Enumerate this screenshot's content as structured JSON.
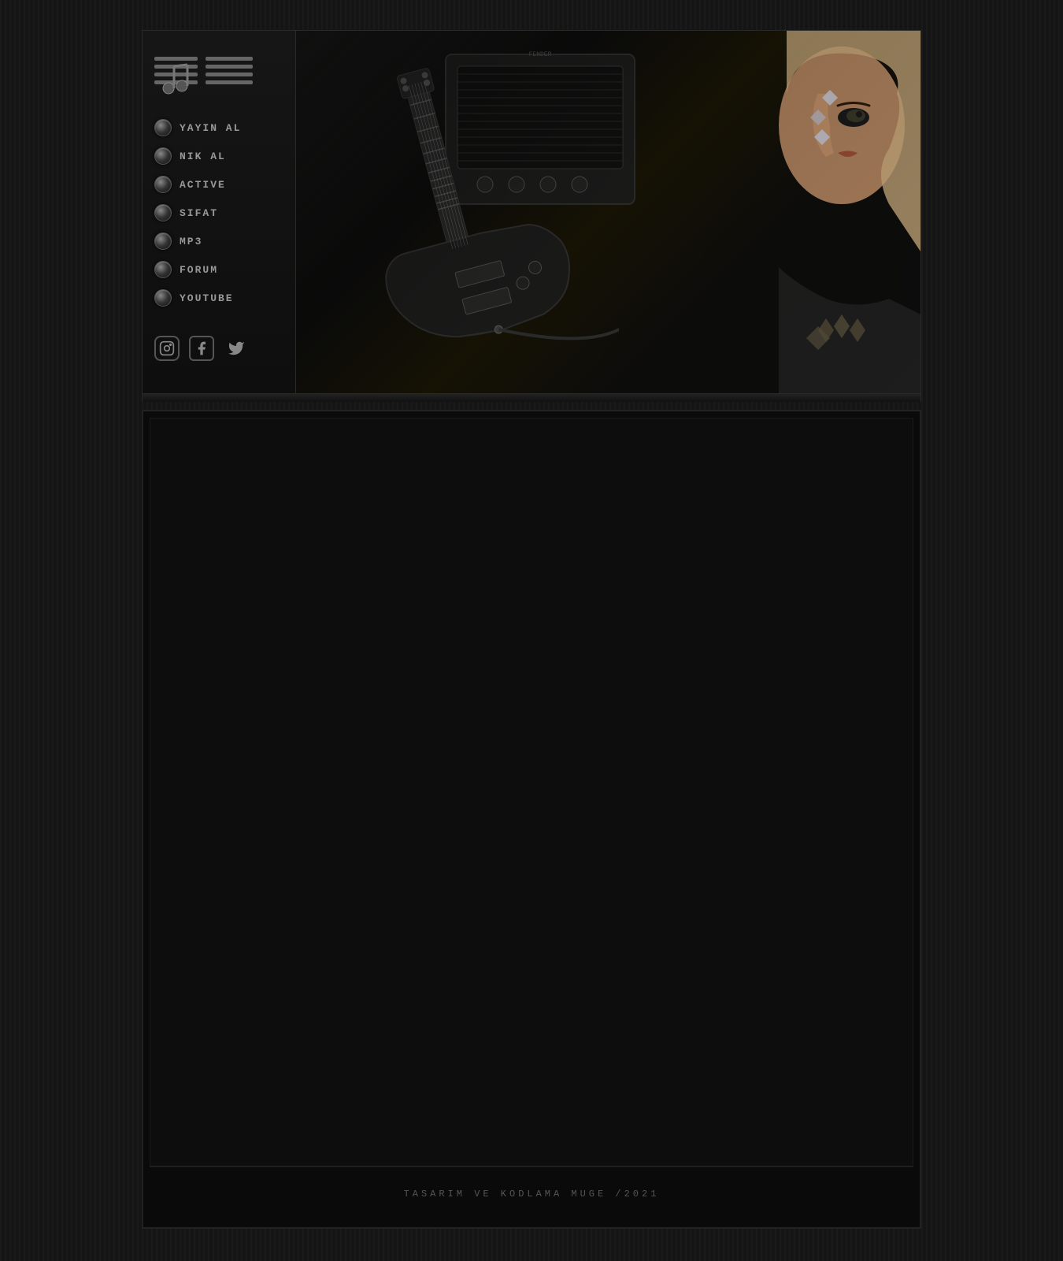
{
  "site": {
    "background_color": "#111111"
  },
  "nav": {
    "items": [
      {
        "id": "yayin-al",
        "label": "YAYIN AL"
      },
      {
        "id": "nik-al",
        "label": "NIK AL"
      },
      {
        "id": "active",
        "label": "ACTIVE"
      },
      {
        "id": "sifat",
        "label": "SIFAT"
      },
      {
        "id": "mp3",
        "label": "MP3"
      },
      {
        "id": "forum",
        "label": "FORUM"
      },
      {
        "id": "youtube",
        "label": "YOUTUBE"
      }
    ]
  },
  "social": {
    "instagram_label": "instagram-icon",
    "facebook_label": "facebook-icon",
    "twitter_label": "twitter-icon"
  },
  "footer": {
    "text": "TASARIM VE KODLAMA MUGE /2021"
  },
  "logo": {
    "alt": "Site Logo"
  }
}
